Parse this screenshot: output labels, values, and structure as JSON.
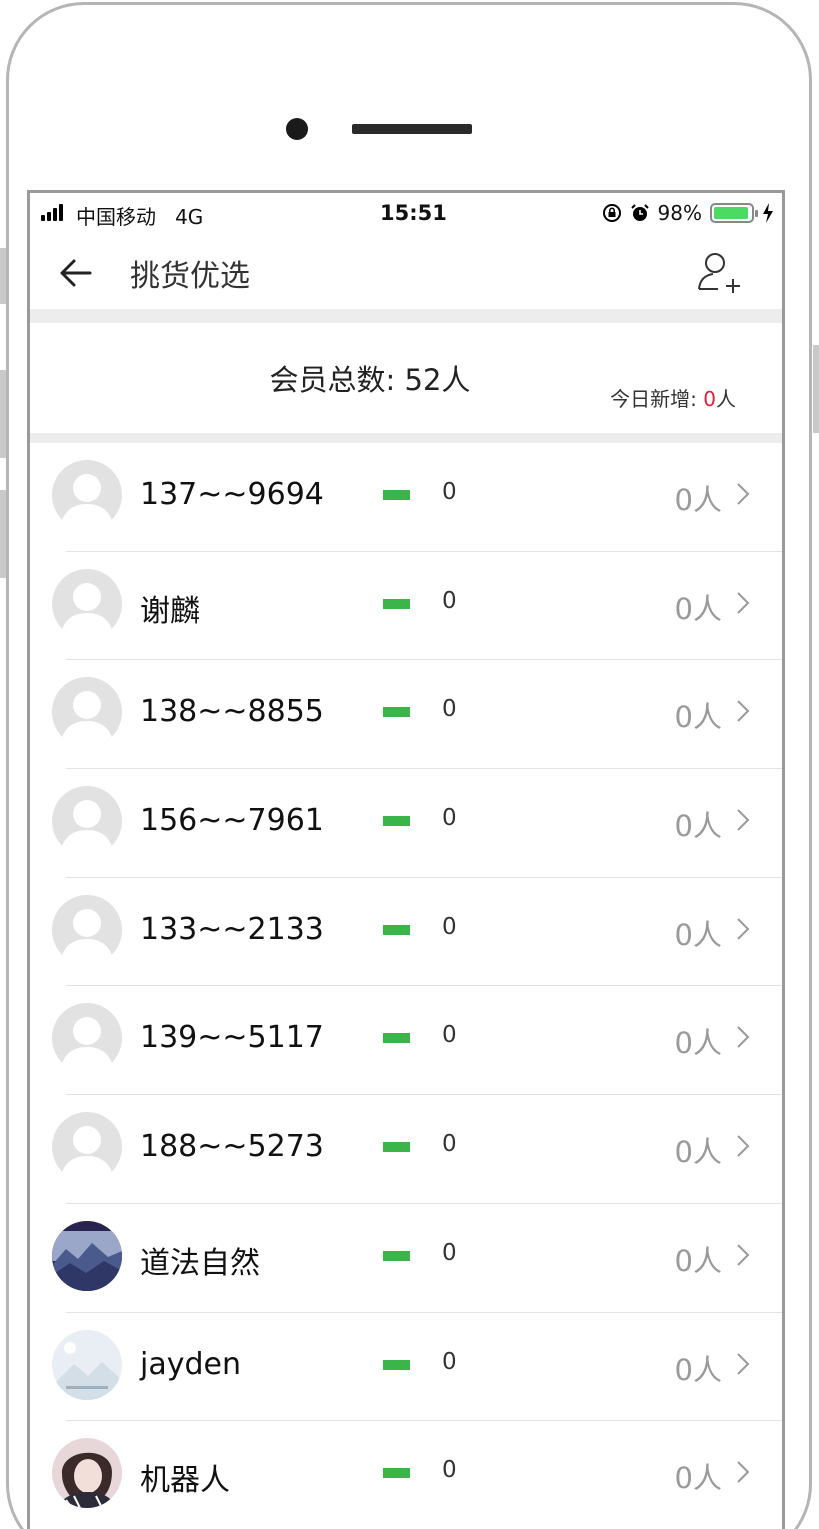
{
  "status_bar": {
    "carrier": "中国移动",
    "network": "4G",
    "time": "15:51",
    "battery": "98%"
  },
  "header": {
    "title": "挑货优选",
    "back_icon": "arrow-left-icon",
    "add_icon": "add-user-icon"
  },
  "summary": {
    "total": "会员总数: 52人",
    "today_label": "今日新增: ",
    "today_count": "0",
    "today_unit": "人"
  },
  "members": [
    {
      "name": "137~~9694",
      "count": "0",
      "people": "0人",
      "avatar": "default"
    },
    {
      "name": "谢麟",
      "count": "0",
      "people": "0人",
      "avatar": "default"
    },
    {
      "name": "138~~8855",
      "count": "0",
      "people": "0人",
      "avatar": "default"
    },
    {
      "name": "156~~7961",
      "count": "0",
      "people": "0人",
      "avatar": "default"
    },
    {
      "name": "133~~2133",
      "count": "0",
      "people": "0人",
      "avatar": "default"
    },
    {
      "name": "139~~5117",
      "count": "0",
      "people": "0人",
      "avatar": "default"
    },
    {
      "name": "188~~5273",
      "count": "0",
      "people": "0人",
      "avatar": "default"
    },
    {
      "name": "道法自然",
      "count": "0",
      "people": "0人",
      "avatar": "mountain"
    },
    {
      "name": "jayden",
      "count": "0",
      "people": "0人",
      "avatar": "placeholder"
    },
    {
      "name": "机器人",
      "count": "0",
      "people": "0人",
      "avatar": "portrait"
    }
  ],
  "colors": {
    "accent_green": "#3bb54a",
    "highlight_red": "#e0203a",
    "muted_text": "#9a9a9a"
  }
}
